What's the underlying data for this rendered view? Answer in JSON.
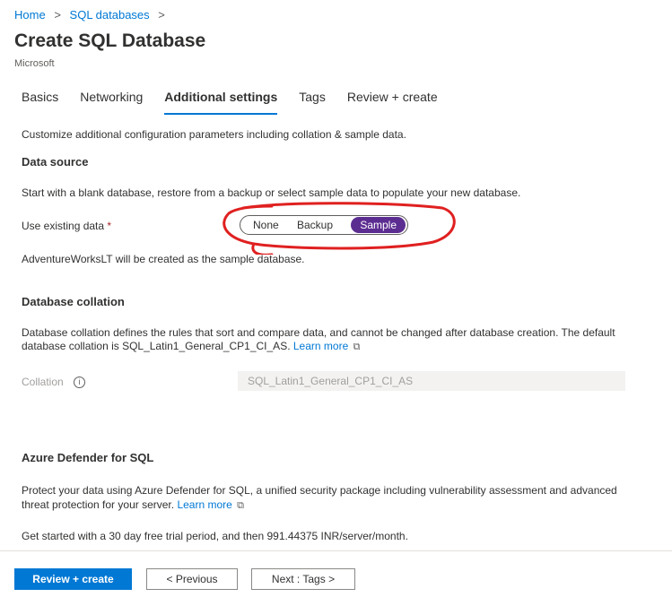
{
  "breadcrumb": {
    "home": "Home",
    "sep1": ">",
    "sql_databases": "SQL databases",
    "sep2": ">"
  },
  "header": {
    "title": "Create SQL Database",
    "subtitle": "Microsoft"
  },
  "tabs": [
    {
      "label": "Basics"
    },
    {
      "label": "Networking"
    },
    {
      "label": "Additional settings"
    },
    {
      "label": "Tags"
    },
    {
      "label": "Review + create"
    }
  ],
  "intro": "Customize additional configuration parameters including collation & sample data.",
  "data_source": {
    "heading": "Data source",
    "description": "Start with a blank database, restore from a backup or select sample data to populate your new database.",
    "label": "Use existing data",
    "required_mark": "*",
    "options": [
      "None",
      "Backup",
      "Sample"
    ],
    "selected": "Sample",
    "note": "AdventureWorksLT will be created as the sample database."
  },
  "collation": {
    "heading": "Database collation",
    "description": "Database collation defines the rules that sort and compare data, and cannot be changed after database creation. The default database collation is SQL_Latin1_General_CP1_CI_AS.",
    "learn_more": "Learn more",
    "label": "Collation",
    "value": "SQL_Latin1_General_CP1_CI_AS"
  },
  "defender": {
    "heading": "Azure Defender for SQL",
    "description": "Protect your data using Azure Defender for SQL, a unified security package including vulnerability assessment and advanced threat protection for your server.",
    "learn_more": "Learn more",
    "trial": "Get started with a 30 day free trial period, and then 991.44375 INR/server/month."
  },
  "footer": {
    "review_create": "Review + create",
    "previous": "< Previous",
    "next": "Next : Tags >"
  },
  "colors": {
    "accent": "#0078d4",
    "selected_toggle": "#5c2d91",
    "annotation": "#e02020",
    "required": "#a4262c"
  }
}
